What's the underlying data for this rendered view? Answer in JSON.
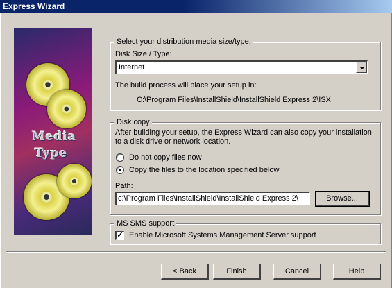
{
  "window": {
    "title": "Express Wizard"
  },
  "art": {
    "label_line1": "Media",
    "label_line2": "Type"
  },
  "media_group": {
    "title": "Select your distribution media size/type.",
    "disk_size_label": "Disk Size / Type:",
    "disk_size_value": "Internet",
    "build_info": "The build process will place your setup in:",
    "build_path": "C:\\Program Files\\InstallShield\\InstallShield Express 2\\ISX"
  },
  "disk_copy_group": {
    "title": "Disk copy",
    "description_line1": "After building your setup, the Express Wizard can also copy your installation",
    "description_line2": "to a disk drive or network location.",
    "radio_no_copy": "Do not copy files now",
    "radio_copy": "Copy the files to the location specified below",
    "selected": "copy",
    "path_label": "Path:",
    "path_value": "c:\\Program Files\\InstallShield\\InstallShield Express 2\\",
    "browse_label": "Browse..."
  },
  "sms_group": {
    "title": "MS SMS support",
    "checkbox_label": "Enable Microsoft Systems Management Server support",
    "checked": true
  },
  "footer": {
    "back_label": "< Back",
    "finish_label": "Finish",
    "cancel_label": "Cancel",
    "help_label": "Help"
  },
  "colors": {
    "titlebar": "#0a246a",
    "dialog_bg": "#d4d0c8"
  }
}
